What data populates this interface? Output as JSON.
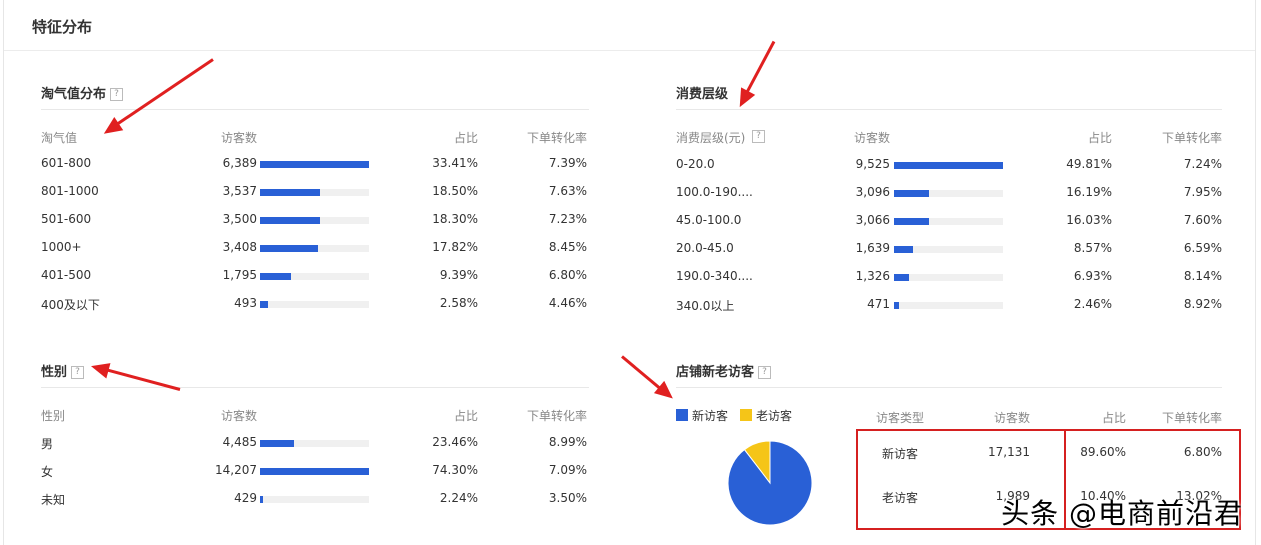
{
  "page_title": "特征分布",
  "help_glyph": "?",
  "panels": {
    "taoqi": {
      "title": "淘气值分布",
      "headers": {
        "label": "淘气值",
        "count": "访客数",
        "pct": "占比",
        "conv": "下单转化率"
      },
      "rows": [
        {
          "label": "601-800",
          "count": "6,389",
          "ratio": 1.0,
          "pct": "33.41%",
          "conv": "7.39%"
        },
        {
          "label": "801-1000",
          "count": "3,537",
          "ratio": 0.554,
          "pct": "18.50%",
          "conv": "7.63%"
        },
        {
          "label": "501-600",
          "count": "3,500",
          "ratio": 0.548,
          "pct": "18.30%",
          "conv": "7.23%"
        },
        {
          "label": "1000+",
          "count": "3,408",
          "ratio": 0.533,
          "pct": "17.82%",
          "conv": "8.45%"
        },
        {
          "label": "401-500",
          "count": "1,795",
          "ratio": 0.281,
          "pct": "9.39%",
          "conv": "6.80%"
        },
        {
          "label": "400及以下",
          "count": "493",
          "ratio": 0.077,
          "pct": "2.58%",
          "conv": "4.46%"
        }
      ]
    },
    "consume": {
      "title": "消费层级",
      "headers": {
        "label": "消费层级(元)",
        "count": "访客数",
        "pct": "占比",
        "conv": "下单转化率"
      },
      "rows": [
        {
          "label": "0-20.0",
          "count": "9,525",
          "ratio": 1.0,
          "pct": "49.81%",
          "conv": "7.24%"
        },
        {
          "label": "100.0-190....",
          "count": "3,096",
          "ratio": 0.325,
          "pct": "16.19%",
          "conv": "7.95%"
        },
        {
          "label": "45.0-100.0",
          "count": "3,066",
          "ratio": 0.322,
          "pct": "16.03%",
          "conv": "7.60%"
        },
        {
          "label": "20.0-45.0",
          "count": "1,639",
          "ratio": 0.172,
          "pct": "8.57%",
          "conv": "6.59%"
        },
        {
          "label": "190.0-340....",
          "count": "1,326",
          "ratio": 0.139,
          "pct": "6.93%",
          "conv": "8.14%"
        },
        {
          "label": "340.0以上",
          "count": "471",
          "ratio": 0.049,
          "pct": "2.46%",
          "conv": "8.92%"
        }
      ]
    },
    "gender": {
      "title": "性别",
      "headers": {
        "label": "性别",
        "count": "访客数",
        "pct": "占比",
        "conv": "下单转化率"
      },
      "rows": [
        {
          "label": "男",
          "count": "4,485",
          "ratio": 0.316,
          "pct": "23.46%",
          "conv": "8.99%"
        },
        {
          "label": "女",
          "count": "14,207",
          "ratio": 1.0,
          "pct": "74.30%",
          "conv": "7.09%"
        },
        {
          "label": "未知",
          "count": "429",
          "ratio": 0.03,
          "pct": "2.24%",
          "conv": "3.50%"
        }
      ]
    },
    "visitors": {
      "title": "店铺新老访客",
      "legend": [
        {
          "label": "新访客",
          "color": "#2960d6"
        },
        {
          "label": "老访客",
          "color": "#f5c518"
        }
      ],
      "headers": {
        "type": "访客类型",
        "count": "访客数",
        "pct": "占比",
        "conv": "下单转化率"
      },
      "rows": [
        {
          "type": "新访客",
          "count": "17,131",
          "pct": "89.60%",
          "conv": "6.80%"
        },
        {
          "type": "老访客",
          "count": "1,989",
          "pct": "10.40%",
          "conv": "13.02%"
        }
      ],
      "pie": [
        0.896,
        0.104
      ]
    }
  },
  "watermark": "头条 @电商前沿君"
}
